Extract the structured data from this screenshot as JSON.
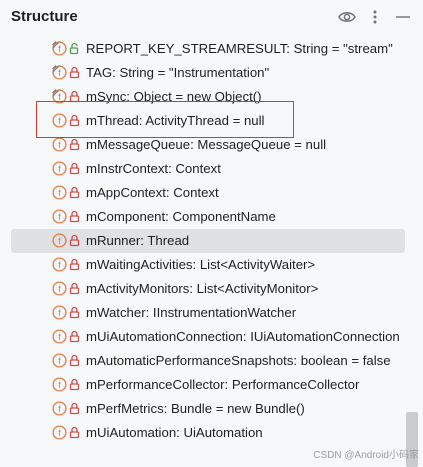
{
  "header": {
    "title": "Structure",
    "icons": [
      "eye-icon",
      "more-vertical-icon",
      "minimize-icon"
    ]
  },
  "colors": {
    "field_icon_orange": "#e07b39",
    "lock_red": "#d64a4a",
    "public_green": "#4aa04a",
    "selection_bg": "#dfe1e5",
    "highlight_border": "#e5322d"
  },
  "items": [
    {
      "label": "REPORT_KEY_STREAMRESULT: String = \"stream\"",
      "icon": "static-field-icon",
      "visibility": "public-icon"
    },
    {
      "label": "TAG: String = \"Instrumentation\"",
      "icon": "static-field-icon",
      "visibility": "lock-icon"
    },
    {
      "label": "mSync: Object = new Object()",
      "icon": "static-field-icon",
      "visibility": "lock-icon"
    },
    {
      "label": "mThread: ActivityThread = null",
      "icon": "field-icon",
      "visibility": "lock-icon"
    },
    {
      "label": "mMessageQueue: MessageQueue = null",
      "icon": "field-icon",
      "visibility": "lock-icon"
    },
    {
      "label": "mInstrContext: Context",
      "icon": "field-icon",
      "visibility": "lock-icon"
    },
    {
      "label": "mAppContext: Context",
      "icon": "field-icon",
      "visibility": "lock-icon"
    },
    {
      "label": "mComponent: ComponentName",
      "icon": "field-icon",
      "visibility": "lock-icon"
    },
    {
      "label": "mRunner: Thread",
      "icon": "field-icon",
      "visibility": "lock-icon"
    },
    {
      "label": "mWaitingActivities: List<ActivityWaiter>",
      "icon": "field-icon",
      "visibility": "lock-icon"
    },
    {
      "label": "mActivityMonitors: List<ActivityMonitor>",
      "icon": "field-icon",
      "visibility": "lock-icon"
    },
    {
      "label": "mWatcher: IInstrumentationWatcher",
      "icon": "field-icon",
      "visibility": "lock-icon"
    },
    {
      "label": "mUiAutomationConnection: IUiAutomationConnection",
      "icon": "field-icon",
      "visibility": "lock-icon"
    },
    {
      "label": "mAutomaticPerformanceSnapshots: boolean = false",
      "icon": "field-icon",
      "visibility": "lock-icon"
    },
    {
      "label": "mPerformanceCollector: PerformanceCollector",
      "icon": "field-icon",
      "visibility": "lock-icon"
    },
    {
      "label": "mPerfMetrics: Bundle = new Bundle()",
      "icon": "field-icon",
      "visibility": "lock-icon"
    },
    {
      "label": "mUiAutomation: UiAutomation",
      "icon": "field-icon",
      "visibility": "lock-icon"
    }
  ],
  "watermark": "CSDN @Android小码家"
}
